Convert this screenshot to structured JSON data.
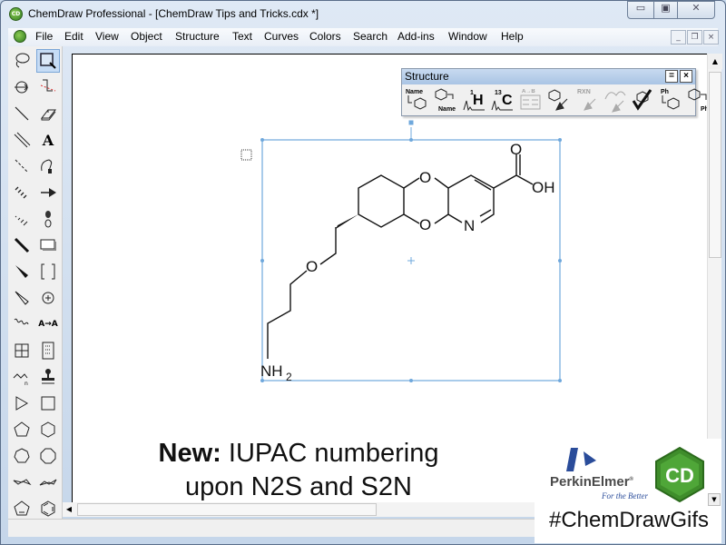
{
  "window": {
    "title": "ChemDraw Professional - [ChemDraw Tips and Tricks.cdx *]",
    "app_icon_label": "CD",
    "controls": {
      "minimize": "▭",
      "maximize": "▣",
      "close": "✕"
    }
  },
  "menubar": {
    "items": [
      {
        "label": "File",
        "accel": "F"
      },
      {
        "label": "Edit",
        "accel": "E"
      },
      {
        "label": "View",
        "accel": "V"
      },
      {
        "label": "Object",
        "accel": "O"
      },
      {
        "label": "Structure",
        "accel": "S"
      },
      {
        "label": "Text",
        "accel": "x"
      },
      {
        "label": "Curves",
        "accel": "C"
      },
      {
        "label": "Colors",
        "accel": "l"
      },
      {
        "label": "Search",
        "accel": ""
      },
      {
        "label": "Add-ins",
        "accel": "A"
      },
      {
        "label": "Window",
        "accel": "W"
      },
      {
        "label": "Help",
        "accel": "H"
      }
    ],
    "mdi_controls": {
      "minimize": "_",
      "restore": "❐",
      "close": "×"
    }
  },
  "toolbox": {
    "tools": [
      {
        "name": "lasso",
        "selected": false
      },
      {
        "name": "marquee",
        "selected": true
      },
      {
        "name": "structure-perspective",
        "selected": false
      },
      {
        "name": "mass-fragmentation",
        "selected": false
      },
      {
        "name": "solid-bond",
        "selected": false
      },
      {
        "name": "eraser",
        "selected": false
      },
      {
        "name": "multiple-bond",
        "selected": false
      },
      {
        "name": "text",
        "selected": false
      },
      {
        "name": "dashed-bond",
        "selected": false
      },
      {
        "name": "pen",
        "selected": false
      },
      {
        "name": "hashed-bond",
        "selected": false
      },
      {
        "name": "arrow",
        "selected": false
      },
      {
        "name": "hashed-wedge-bond",
        "selected": false
      },
      {
        "name": "orbital",
        "selected": false
      },
      {
        "name": "bold-bond",
        "selected": false
      },
      {
        "name": "drawing-elements",
        "selected": false
      },
      {
        "name": "wedge-bond",
        "selected": false
      },
      {
        "name": "brackets",
        "selected": false
      },
      {
        "name": "hollow-wedge-bond",
        "selected": false
      },
      {
        "name": "chemical-symbols",
        "selected": false
      },
      {
        "name": "wavy-bond",
        "selected": false
      },
      {
        "name": "atom-atom-map",
        "selected": false
      },
      {
        "name": "table",
        "selected": false
      },
      {
        "name": "tlc-plate",
        "selected": false
      },
      {
        "name": "chain",
        "selected": false
      },
      {
        "name": "templates",
        "selected": false
      },
      {
        "name": "cyclopropane",
        "selected": false
      },
      {
        "name": "cyclobutane",
        "selected": false
      },
      {
        "name": "cyclopentane",
        "selected": false
      },
      {
        "name": "cyclohexane",
        "selected": false
      },
      {
        "name": "cycloheptane",
        "selected": false
      },
      {
        "name": "cyclooctane",
        "selected": false
      },
      {
        "name": "cyclohexane-chair-1",
        "selected": false
      },
      {
        "name": "cyclohexane-chair-2",
        "selected": false
      },
      {
        "name": "cyclopentadiene",
        "selected": false
      },
      {
        "name": "benzene",
        "selected": false
      }
    ],
    "text_tool_glyph": "A",
    "atom_map_glyph": "A→A"
  },
  "structure_palette": {
    "title": "Structure",
    "tools": [
      {
        "name": "name-to-structure",
        "top": "Name",
        "bottom": "",
        "enabled": true
      },
      {
        "name": "structure-to-name",
        "top": "",
        "bottom": "Name",
        "enabled": true
      },
      {
        "name": "predict-1h-nmr",
        "top": "1H",
        "bottom": "",
        "enabled": true
      },
      {
        "name": "predict-13c-nmr",
        "top": "13C",
        "bottom": "",
        "enabled": true
      },
      {
        "name": "reaction-table",
        "top": "A→B",
        "bottom": "",
        "enabled": false
      },
      {
        "name": "clean-up-structure",
        "top": "",
        "bottom": "",
        "enabled": true
      },
      {
        "name": "clean-up-reaction",
        "top": "RXN",
        "bottom": "",
        "enabled": false
      },
      {
        "name": "clean-up-biopolymer",
        "top": "",
        "bottom": "",
        "enabled": false
      },
      {
        "name": "check-structure",
        "top": "",
        "bottom": "",
        "enabled": true
      },
      {
        "name": "expand-label",
        "top": "Ph",
        "bottom": "",
        "enabled": true
      },
      {
        "name": "contract-label",
        "top": "",
        "bottom": "Ph",
        "enabled": true
      }
    ]
  },
  "molecule": {
    "labels": {
      "o_ring_top": "O",
      "o_ring_bottom": "O",
      "n_pyridine": "N",
      "o_carbonyl": "O",
      "oh": "OH",
      "o_ether": "O",
      "nh2": "NH",
      "nh2_sub": "2"
    },
    "selection_color": "#6fa8dc"
  },
  "caption": {
    "bold": "New:",
    "line1": " IUPAC numbering",
    "line2": "upon N2S and S2N"
  },
  "branding": {
    "company": "PerkinElmer",
    "trademark": "®",
    "tagline": "For the Better",
    "product_badge": "CD",
    "hashtag": "#ChemDrawGifs",
    "brand_blue": "#2a4c9a",
    "badge_green": "#3f8d2b"
  }
}
